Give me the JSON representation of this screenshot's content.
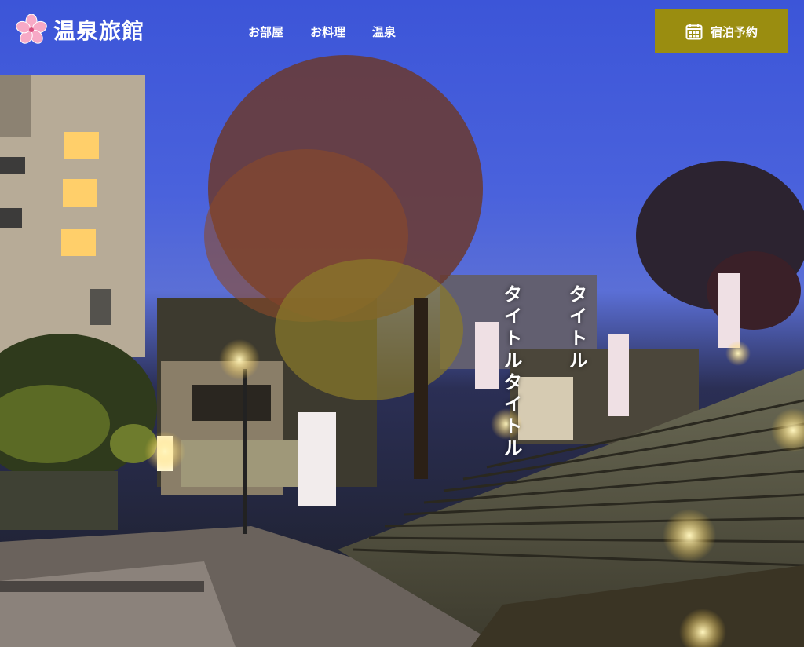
{
  "site": {
    "logo_text": "温泉旅館",
    "logo_icon": "sakura-flower-icon"
  },
  "nav": {
    "items": [
      {
        "label": "お部屋"
      },
      {
        "label": "お料理"
      },
      {
        "label": "温泉"
      }
    ]
  },
  "reserve": {
    "label": "宿泊予約",
    "icon": "calendar-icon",
    "color": "#9a8d10"
  },
  "hero": {
    "title_right": "タイトル",
    "title_left": "タイトルタイトル"
  }
}
